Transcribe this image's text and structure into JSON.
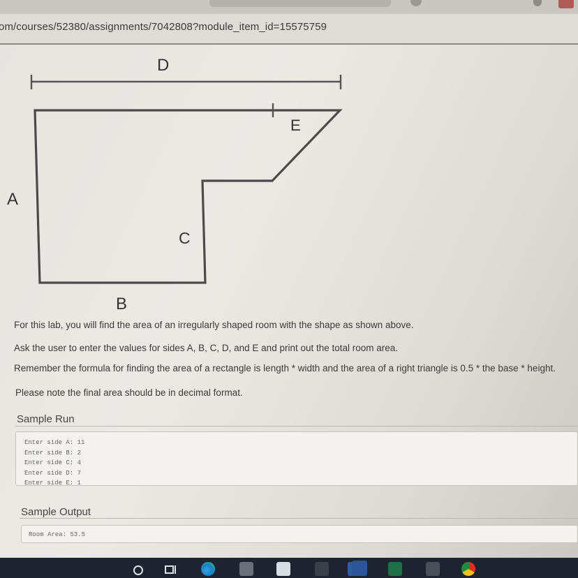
{
  "browser": {
    "url": "om/courses/52380/assignments/7042808?module_item_id=15575759"
  },
  "diagram": {
    "labels": {
      "a": "A",
      "b": "B",
      "c": "C",
      "d": "D",
      "e": "E"
    }
  },
  "instructions": [
    "For this lab, you will find the area of an irregularly shaped room with the shape as shown above.",
    "Ask the user to enter the values for sides A, B, C, D, and E and print out the total room area.",
    "Remember the formula for finding the area of a rectangle is length * width and the area of a right triangle is 0.5 * the base * height.",
    "Please note the final area should be in decimal format."
  ],
  "sample_run": {
    "title": "Sample Run",
    "lines": [
      "Enter side A: 11",
      "Enter side B: 2",
      "Enter side C: 4",
      "Enter side D: 7",
      "Enter side E: 1"
    ]
  },
  "sample_output": {
    "title": "Sample Output",
    "lines": [
      "Room Area: 53.5"
    ]
  },
  "taskbar": {
    "icons": [
      "search-icon",
      "task-view-icon",
      "edge-icon",
      "store-icon",
      "lock-icon",
      "calculator-icon",
      "mail-icon",
      "word-icon",
      "excel-icon",
      "snip-icon",
      "chrome-icon"
    ]
  }
}
